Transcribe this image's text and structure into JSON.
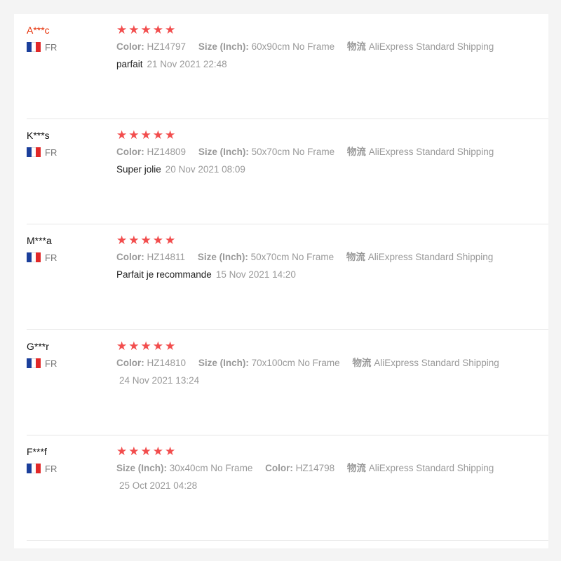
{
  "reviews": [
    {
      "user": "A***c",
      "country": "FR",
      "stars": 5,
      "attr1_label": "Color:",
      "attr1_value": "HZ14797",
      "attr2_label": "Size (Inch):",
      "attr2_value": "60x90cm No Frame",
      "attr3_label": "物流",
      "attr3_value": "AliExpress Standard Shipping",
      "text": "parfait",
      "date": "21 Nov 2021 22:48"
    },
    {
      "user": "K***s",
      "country": "FR",
      "stars": 5,
      "attr1_label": "Color:",
      "attr1_value": "HZ14809",
      "attr2_label": "Size (Inch):",
      "attr2_value": "50x70cm No Frame",
      "attr3_label": "物流",
      "attr3_value": "AliExpress Standard Shipping",
      "text": "Super jolie",
      "date": "20 Nov 2021 08:09"
    },
    {
      "user": "M***a",
      "country": "FR",
      "stars": 5,
      "attr1_label": "Color:",
      "attr1_value": "HZ14811",
      "attr2_label": "Size (Inch):",
      "attr2_value": "50x70cm No Frame",
      "attr3_label": "物流",
      "attr3_value": "AliExpress Standard Shipping",
      "text": "Parfait je recommande",
      "date": "15 Nov 2021 14:20"
    },
    {
      "user": "G***r",
      "country": "FR",
      "stars": 5,
      "attr1_label": "Color:",
      "attr1_value": "HZ14810",
      "attr2_label": "Size (Inch):",
      "attr2_value": "70x100cm No Frame",
      "attr3_label": "物流",
      "attr3_value": "AliExpress Standard Shipping",
      "text": "",
      "date": "24 Nov 2021 13:24"
    },
    {
      "user": "F***f",
      "country": "FR",
      "stars": 5,
      "attr1_label": "Size (Inch):",
      "attr1_value": "30x40cm No Frame",
      "attr2_label": "Color:",
      "attr2_value": "HZ14798",
      "attr3_label": "物流",
      "attr3_value": "AliExpress Standard Shipping",
      "text": "",
      "date": "25 Oct 2021 04:28"
    }
  ],
  "colors": {
    "star": "#f24d4d",
    "highlight_user": "#e62e04",
    "muted": "#999999"
  },
  "icons": {
    "star": "star-icon",
    "flag": "france-flag-icon"
  }
}
